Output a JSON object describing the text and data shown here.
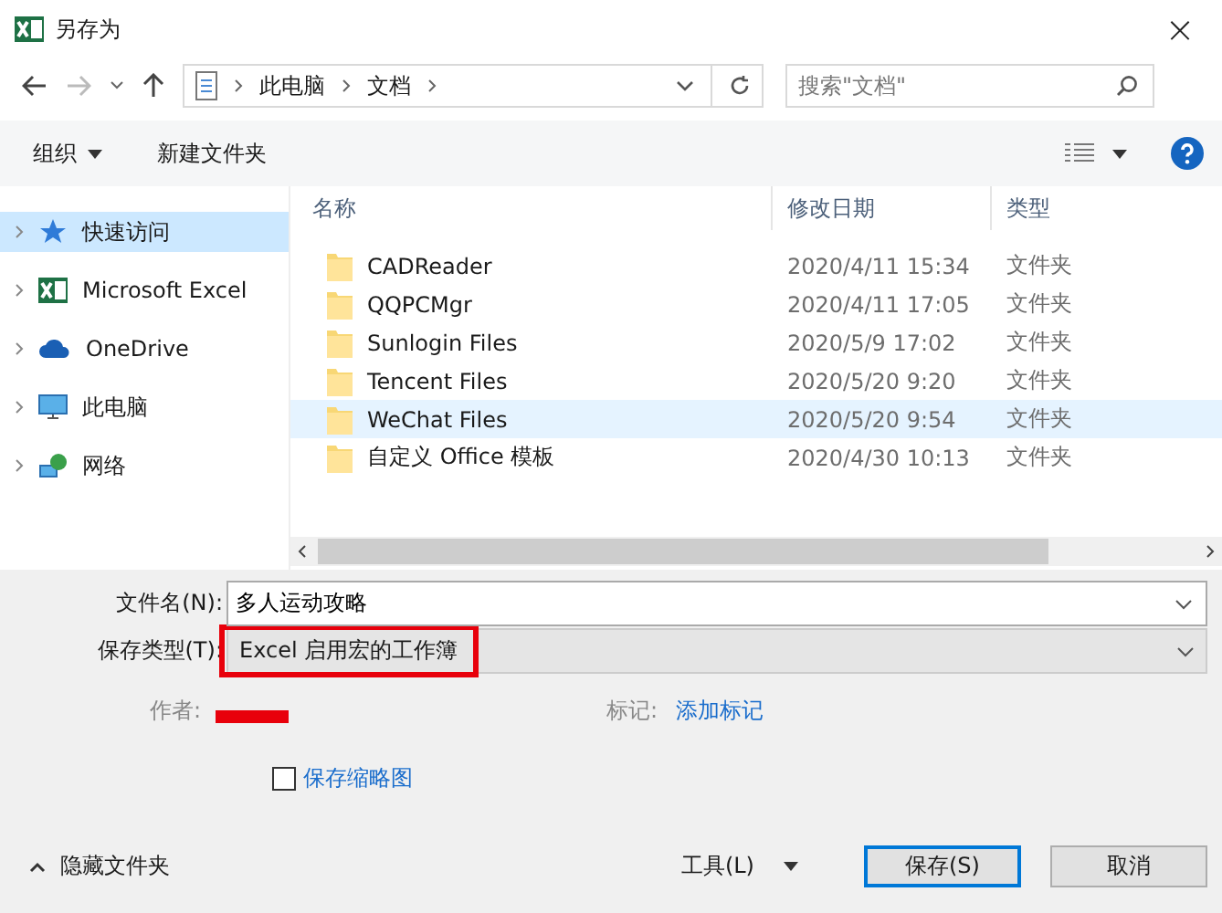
{
  "window": {
    "title": "另存为",
    "close": "×"
  },
  "address": {
    "path": [
      "此电脑",
      "文档"
    ],
    "search_placeholder": "搜索\"文档\""
  },
  "toolbar": {
    "organize": "组织",
    "new_folder": "新建文件夹"
  },
  "sidebar": {
    "items": [
      {
        "label": "快速访问",
        "kind": "quick",
        "selected": true
      },
      {
        "label": "Microsoft Excel",
        "kind": "app",
        "selected": false
      },
      {
        "label": "OneDrive",
        "kind": "cloud",
        "selected": false
      },
      {
        "label": "此电脑",
        "kind": "pc",
        "selected": false
      },
      {
        "label": "网络",
        "kind": "network",
        "selected": false
      }
    ]
  },
  "table": {
    "columns": [
      "名称",
      "修改日期",
      "类型"
    ],
    "rows": [
      {
        "name": "CADReader",
        "date": "2020/4/11 15:34",
        "type": "文件夹",
        "selected": false
      },
      {
        "name": "QQPCMgr",
        "date": "2020/4/11 17:05",
        "type": "文件夹",
        "selected": false
      },
      {
        "name": "Sunlogin Files",
        "date": "2020/5/9 17:02",
        "type": "文件夹",
        "selected": false
      },
      {
        "name": "Tencent Files",
        "date": "2020/5/20 9:20",
        "type": "文件夹",
        "selected": false
      },
      {
        "name": "WeChat Files",
        "date": "2020/5/20 9:54",
        "type": "文件夹",
        "selected": true
      },
      {
        "name": "自定义 Office 模板",
        "date": "2020/4/30 10:13",
        "type": "文件夹",
        "selected": false
      }
    ]
  },
  "form": {
    "filename_label": "文件名(N):",
    "filename": "多人运动攻略",
    "type_label": "保存类型(T):",
    "type": "Excel 启用宏的工作簿",
    "type_highlighted": true,
    "author_label": "作者:",
    "author_redacted": true,
    "tags_label": "标记:",
    "tags_link": "添加标记",
    "thumbnail_label": "保存缩略图",
    "thumbnail_checked": false
  },
  "footer": {
    "hide_folders": "隐藏文件夹",
    "tools": "工具(L)",
    "save": "保存(S)",
    "cancel": "取消"
  }
}
